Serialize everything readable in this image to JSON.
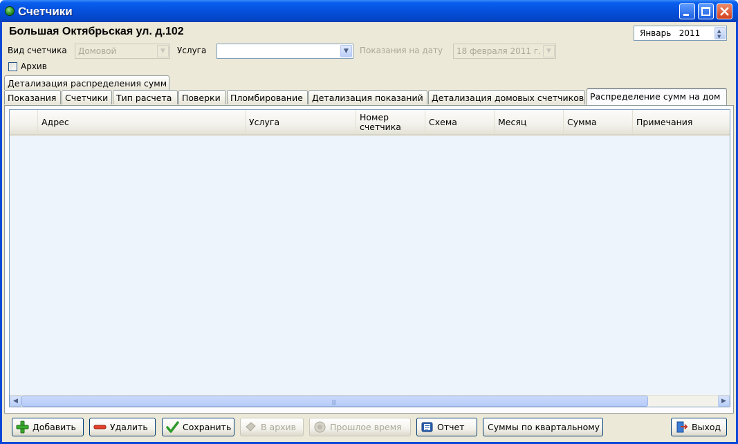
{
  "window": {
    "title": "Счетчики"
  },
  "header": {
    "address": "Большая Октябрьская ул. д.102",
    "month": "Январь",
    "year": "2011"
  },
  "filters": {
    "meter_type_label": "Вид счетчика",
    "meter_type_value": "Домовой",
    "service_label": "Услуга",
    "service_value": "",
    "date_label": "Показания на дату",
    "date_value": "18 февраля 2011 г.",
    "archive_label": "Архив"
  },
  "tabs": {
    "top_row": [
      "Детализация распределения сумм"
    ],
    "bottom_row": [
      "Показания",
      "Счетчики",
      "Тип расчета",
      "Поверки",
      "Пломбирование",
      "Детализация показаний",
      "Детализация домовых счетчиков",
      "Распределение сумм на дом"
    ],
    "active": "Распределение сумм на дом"
  },
  "grid": {
    "columns": [
      "Адрес",
      "Услуга",
      "Номер счетчика",
      "Схема",
      "Месяц",
      "Сумма",
      "Примечания"
    ],
    "rows": []
  },
  "buttons": {
    "add": "Добавить",
    "delete": "Удалить",
    "save": "Сохранить",
    "archive": "В архив",
    "past_time": "Прошлое время",
    "report": "Отчет",
    "quarterly": "Суммы по квартальному",
    "exit": "Выход"
  },
  "icons": [
    "app-globe-icon",
    "minimize-icon",
    "maximize-icon",
    "close-icon",
    "plus-icon",
    "minus-icon",
    "checkmark-icon",
    "archive-icon",
    "clock-icon",
    "report-icon",
    "exit-door-icon"
  ],
  "colors": {
    "titlebar": "#0550dc",
    "active_tab_accent": "#f7a935",
    "face": "#ece9d8",
    "grid_bg": "#eef4fb"
  }
}
